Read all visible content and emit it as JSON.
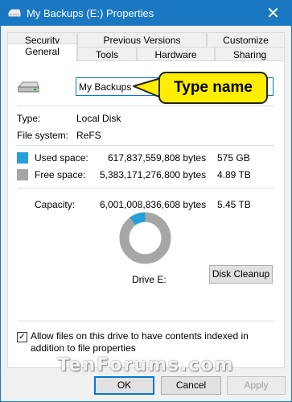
{
  "window": {
    "title": "My Backups (E:) Properties",
    "close_label": "✕"
  },
  "tabs_row1": [
    "Security",
    "Previous Versions",
    "Customize"
  ],
  "tabs_row2": [
    "General",
    "Tools",
    "Hardware",
    "Sharing"
  ],
  "active_tab": "General",
  "general": {
    "name_value": "My Backups",
    "callout_text": "Type name",
    "type_label": "Type:",
    "type_value": "Local Disk",
    "fs_label": "File system:",
    "fs_value": "ReFS",
    "used_label": "Used space:",
    "used_bytes": "617,837,559,808 bytes",
    "used_size": "575 GB",
    "free_label": "Free space:",
    "free_bytes": "5,383,171,276,800 bytes",
    "free_size": "4.89 TB",
    "capacity_label": "Capacity:",
    "capacity_bytes": "6,001,008,836,608 bytes",
    "capacity_size": "5.45 TB",
    "drive_label": "Drive E:",
    "used_fraction": 0.103,
    "used_color": "#26a0da",
    "free_color": "#a6a6a6",
    "cleanup_label": "Disk Cleanup",
    "index_checked": true,
    "index_label": "Allow files on this drive to have contents indexed in addition to file properties"
  },
  "buttons": {
    "ok": "OK",
    "cancel": "Cancel",
    "apply": "Apply"
  },
  "watermark": "TenForums.com",
  "colors": {
    "titlebar": "#1a78c2",
    "callout": "#ffee00"
  }
}
